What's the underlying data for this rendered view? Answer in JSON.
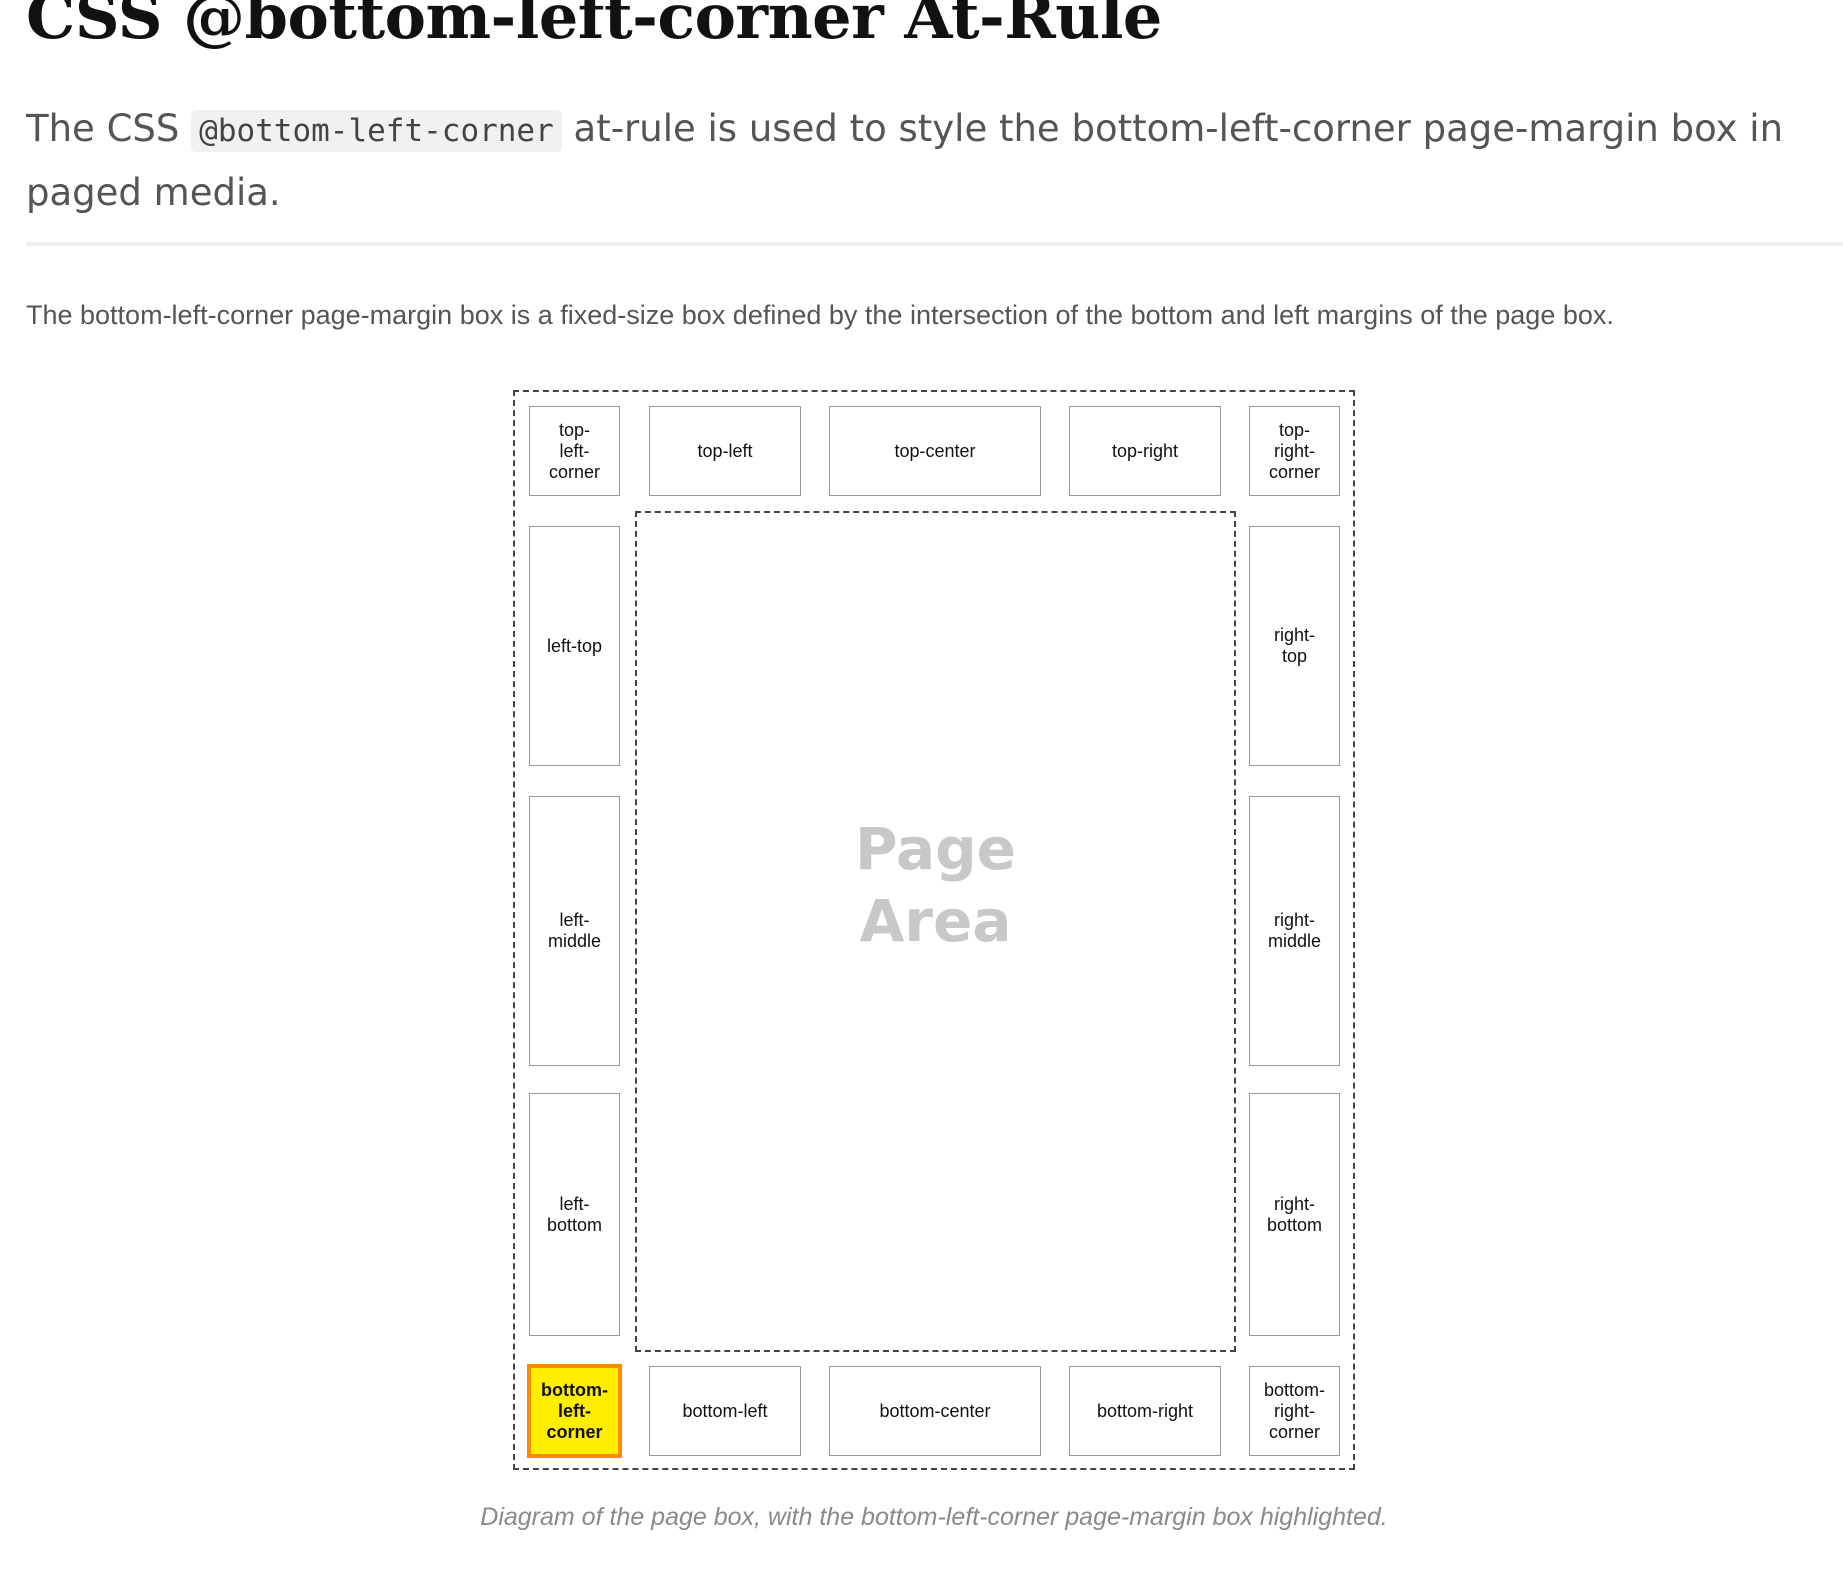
{
  "page": {
    "title": "CSS @bottom-left-corner At-Rule",
    "intro_before": "The CSS ",
    "intro_code": "@bottom-left-corner",
    "intro_after": " at-rule is used to style the bottom-left-corner page-margin box in paged media.",
    "description": "The bottom-left-corner page-margin box is a fixed-size box defined by the intersection of the bottom and left margins of the page box."
  },
  "diagram": {
    "page_area_label": "Page\nArea",
    "highlighted_box": "bottom-left-corner",
    "highlight_fill": "#ffee00",
    "highlight_border": "#ff8c00",
    "boxes": {
      "top_left_corner": "top-\nleft-\ncorner",
      "top_left": "top-left",
      "top_center": "top-center",
      "top_right": "top-right",
      "top_right_corner": "top-\nright-\ncorner",
      "left_top": "left-top",
      "left_middle": "left-\nmiddle",
      "left_bottom": "left-\nbottom",
      "right_top": "right-\ntop",
      "right_middle": "right-\nmiddle",
      "right_bottom": "right-\nbottom",
      "bottom_left_corner": "bottom-\nleft-\ncorner",
      "bottom_left": "bottom-left",
      "bottom_center": "bottom-center",
      "bottom_right": "bottom-right",
      "bottom_right_corner": "bottom-\nright-\ncorner"
    },
    "caption": "Diagram of the page box, with the bottom-left-corner page-margin box highlighted."
  }
}
